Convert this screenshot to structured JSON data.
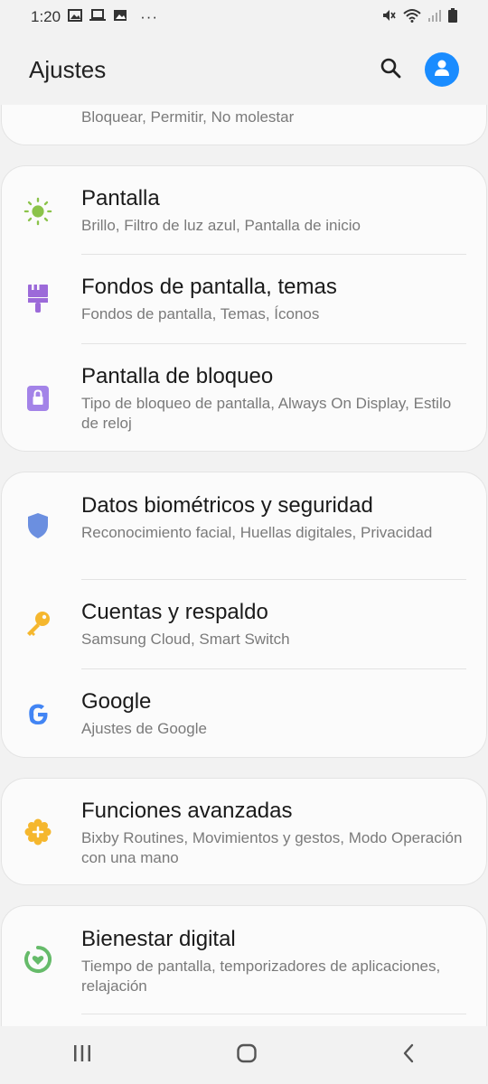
{
  "status": {
    "time": "1:20",
    "more": "···"
  },
  "header": {
    "title": "Ajustes"
  },
  "partial_item": {
    "subtitle": "Bloquear, Permitir, No molestar"
  },
  "groups": [
    {
      "items": [
        {
          "title": "Pantalla",
          "subtitle": "Brillo, Filtro de luz azul, Pantalla de inicio",
          "icon": "sun-icon",
          "color": "#8bc34a"
        },
        {
          "title": "Fondos de pantalla, temas",
          "subtitle": "Fondos de pantalla, Temas, Íconos",
          "icon": "paintbrush-icon",
          "color": "#9c6ad9"
        },
        {
          "title": "Pantalla de bloqueo",
          "subtitle": "Tipo de bloqueo de pantalla, Always On Display, Estilo de reloj",
          "icon": "lock-icon",
          "color": "#a383e8"
        }
      ]
    },
    {
      "items": [
        {
          "title": "Datos biométricos y seguridad",
          "subtitle": "Reconocimiento facial, Huellas digitales, Privacidad",
          "icon": "shield-icon",
          "color": "#6b8fe0"
        },
        {
          "title": "Cuentas y respaldo",
          "subtitle": "Samsung Cloud, Smart Switch",
          "icon": "key-icon",
          "color": "#f5b72e"
        },
        {
          "title": "Google",
          "subtitle": "Ajustes de Google",
          "icon": "google-icon",
          "color": "#4285f4"
        }
      ]
    },
    {
      "items": [
        {
          "title": "Funciones avanzadas",
          "subtitle": "Bixby Routines, Movimientos y gestos, Modo Operación con una mano",
          "icon": "gear-plus-icon",
          "color": "#f5b72e"
        }
      ]
    },
    {
      "items": [
        {
          "title": "Bienestar digital",
          "subtitle": "Tiempo de pantalla, temporizadores de aplicaciones, relajación",
          "icon": "wellbeing-icon",
          "color": "#66bb6a"
        }
      ]
    }
  ]
}
